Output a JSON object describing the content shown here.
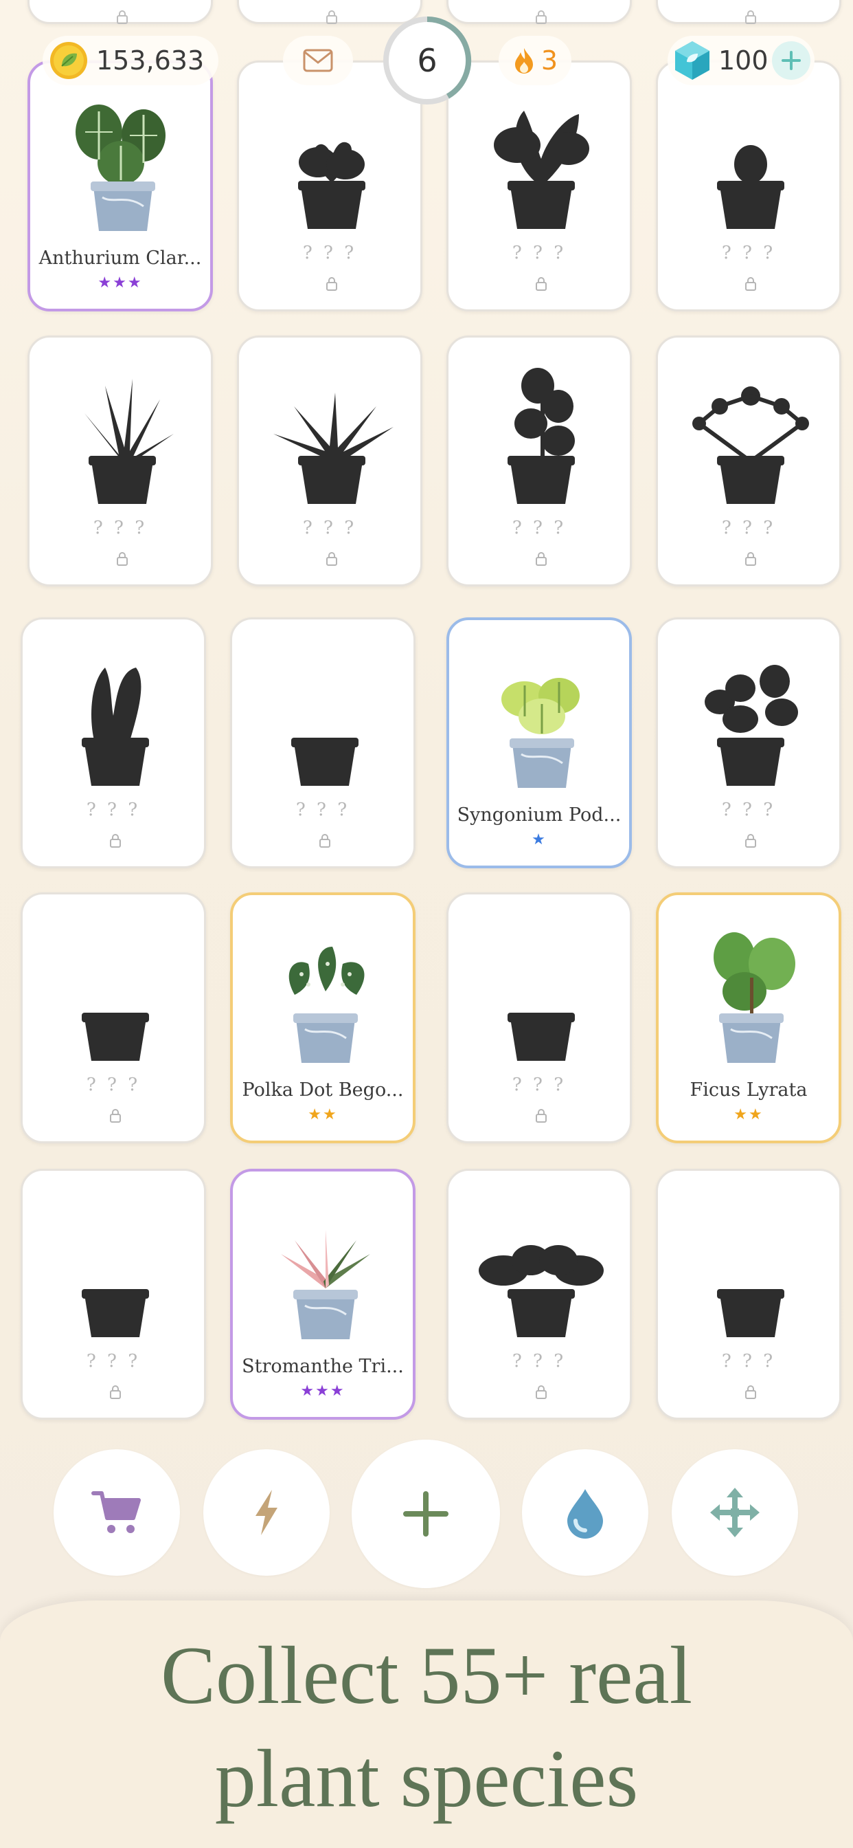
{
  "header": {
    "coins": "153,633",
    "level": "6",
    "streak": "3",
    "gems": "100"
  },
  "grid": {
    "unknown_label": "? ? ?",
    "cards": [
      {
        "name": "Anthurium Clar...",
        "unlocked": true,
        "stars": "★★★",
        "rarity": "purple"
      },
      {
        "name": "",
        "unlocked": false
      },
      {
        "name": "",
        "unlocked": false
      },
      {
        "name": "",
        "unlocked": false
      },
      {
        "name": "",
        "unlocked": false
      },
      {
        "name": "",
        "unlocked": false
      },
      {
        "name": "",
        "unlocked": false
      },
      {
        "name": "",
        "unlocked": false
      },
      {
        "name": "",
        "unlocked": false
      },
      {
        "name": "",
        "unlocked": false
      },
      {
        "name": "Syngonium Pod...",
        "unlocked": true,
        "stars": "★",
        "rarity": "blue"
      },
      {
        "name": "",
        "unlocked": false
      },
      {
        "name": "",
        "unlocked": false
      },
      {
        "name": "Polka Dot Bego...",
        "unlocked": true,
        "stars": "★★",
        "rarity": "gold"
      },
      {
        "name": "",
        "unlocked": false
      },
      {
        "name": "Ficus Lyrata",
        "unlocked": true,
        "stars": "★★",
        "rarity": "gold"
      },
      {
        "name": "",
        "unlocked": false
      },
      {
        "name": "Stromanthe Tri...",
        "unlocked": true,
        "stars": "★★★",
        "rarity": "purple"
      },
      {
        "name": "",
        "unlocked": false
      },
      {
        "name": "",
        "unlocked": false
      }
    ]
  },
  "toolbar": {
    "icons": [
      "cart-icon",
      "lightning-icon",
      "plus-icon",
      "water-drop-icon",
      "move-arrows-icon"
    ]
  },
  "banner": {
    "line1": "Collect 55+ real",
    "line2": "plant species"
  },
  "colors": {
    "accent_green": "#5e7456",
    "purple": "#c39ae6",
    "blue": "#9bbbe9",
    "gold": "#f4cd77"
  }
}
